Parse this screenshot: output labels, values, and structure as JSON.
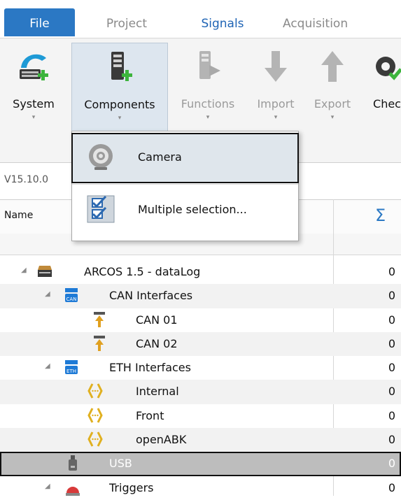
{
  "tabs": {
    "file": "File",
    "project": "Project",
    "signals": "Signals",
    "acquisition": "Acquisition"
  },
  "ribbon": {
    "system": "System",
    "components": "Components",
    "functions": "Functions",
    "import": "Import",
    "export": "Export",
    "check": "Chec",
    "dropdown_arrow": "▾"
  },
  "version": "V15.10.0",
  "table": {
    "name_header": "Name",
    "sum_header": "Σ"
  },
  "dropdown": {
    "camera": "Camera",
    "multiple_selection": "Multiple selection..."
  },
  "tree": [
    {
      "label": "ARCOS 1.5 - dataLog",
      "value": "0",
      "icon": "device-icon"
    },
    {
      "label": "CAN Interfaces",
      "value": "0",
      "icon": "can-interface-icon"
    },
    {
      "label": "CAN 01",
      "value": "0",
      "icon": "can-port-icon"
    },
    {
      "label": "CAN 02",
      "value": "0",
      "icon": "can-port-icon"
    },
    {
      "label": "ETH Interfaces",
      "value": "0",
      "icon": "eth-interface-icon"
    },
    {
      "label": "Internal",
      "value": "0",
      "icon": "eth-port-icon"
    },
    {
      "label": "Front",
      "value": "0",
      "icon": "eth-port-icon"
    },
    {
      "label": "openABK",
      "value": "0",
      "icon": "eth-port-icon"
    },
    {
      "label": "USB",
      "value": "0",
      "icon": "usb-icon"
    },
    {
      "label": "Triggers",
      "value": "0",
      "icon": "trigger-icon"
    }
  ],
  "colors": {
    "file_tab": "#2b78c4",
    "signals_tab": "#1f64b5",
    "selection_highlight": "#bdbdbd",
    "menu_highlight": "#dfe6ec"
  }
}
